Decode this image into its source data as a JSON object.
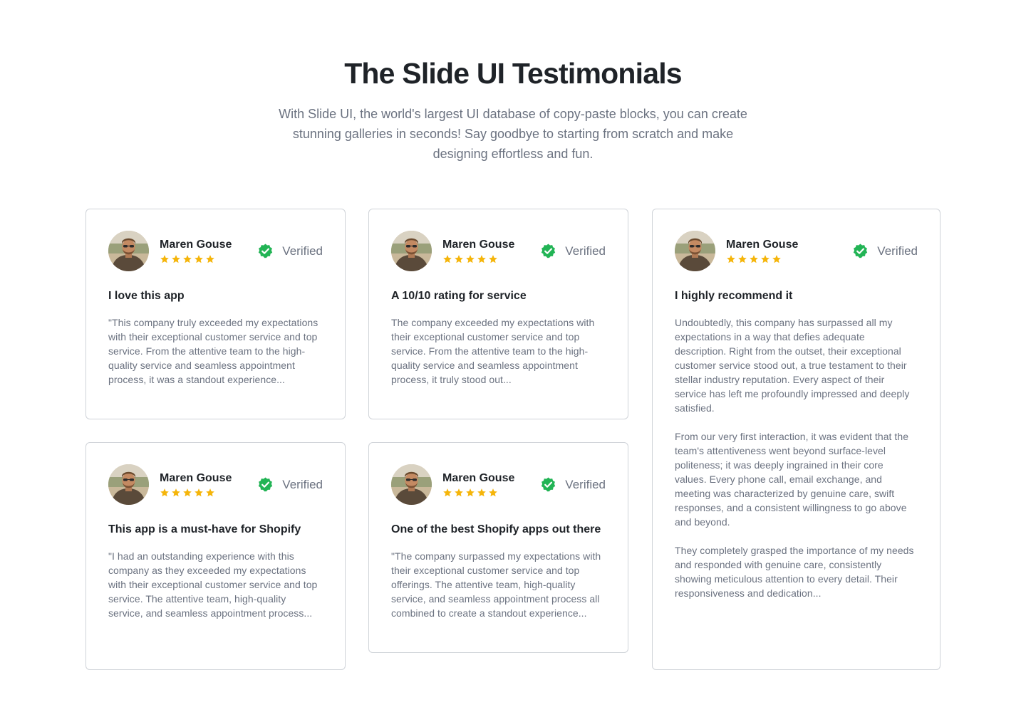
{
  "header": {
    "title": "The Slide UI Testimonials",
    "subtitle": "With Slide UI, the world's largest UI database of copy-paste blocks, you can create stunning galleries in seconds! Say goodbye to starting from scratch and make designing effortless and fun."
  },
  "colors": {
    "star": "#f5b50a",
    "verified": "#22b455",
    "border": "#cfd3d8",
    "muted_text": "#6b7280"
  },
  "testimonials": [
    {
      "author": "Maren Gouse",
      "rating": 5,
      "verified_label": "Verified",
      "title": "I love this app",
      "paragraphs": [
        "\"This company truly exceeded my expectations with their exceptional customer service and top service. From the attentive team to the high-quality service and seamless appointment process, it was a standout experience..."
      ]
    },
    {
      "author": "Maren Gouse",
      "rating": 5,
      "verified_label": "Verified",
      "title": "A 10/10 rating for service",
      "paragraphs": [
        "The company exceeded my expectations with their exceptional customer service and top service. From the attentive team to the high-quality service and seamless appointment process, it truly stood out..."
      ]
    },
    {
      "author": "Maren Gouse",
      "rating": 5,
      "verified_label": "Verified",
      "title": "I highly recommend it",
      "paragraphs": [
        "Undoubtedly, this company has surpassed all my expectations in a way that defies adequate description. Right from the outset, their exceptional customer service stood out, a true testament to their stellar industry reputation. Every aspect of their service has left me profoundly impressed and deeply satisfied.",
        "From our very first interaction, it was evident that the team's attentiveness went beyond surface-level politeness; it was deeply ingrained in their core values. Every phone call, email exchange, and meeting was characterized by genuine care, swift responses, and a consistent willingness to go above and beyond.",
        "They completely grasped the importance of my needs and responded with genuine care, consistently showing meticulous attention to every detail. Their responsiveness and dedication..."
      ]
    },
    {
      "author": "Maren Gouse",
      "rating": 5,
      "verified_label": "Verified",
      "title": "This app is a must-have for Shopify",
      "paragraphs": [
        "\"I had an outstanding experience with this company as they exceeded my expectations with their exceptional customer service and top service. The attentive team, high-quality service, and seamless appointment process..."
      ]
    },
    {
      "author": "Maren Gouse",
      "rating": 5,
      "verified_label": "Verified",
      "title": "One of the best Shopify apps out there",
      "paragraphs": [
        "\"The company surpassed my expectations with their exceptional customer service and top offerings. The attentive team, high-quality service, and seamless appointment process all combined to create a standout experience..."
      ]
    }
  ]
}
